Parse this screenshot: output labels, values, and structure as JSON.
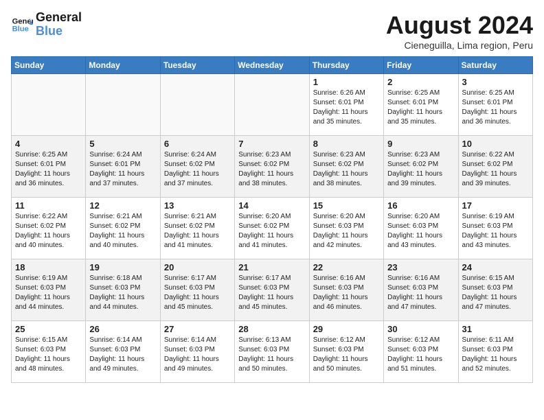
{
  "header": {
    "logo_line1": "General",
    "logo_line2": "Blue",
    "month_title": "August 2024",
    "location": "Cieneguilla, Lima region, Peru"
  },
  "weekdays": [
    "Sunday",
    "Monday",
    "Tuesday",
    "Wednesday",
    "Thursday",
    "Friday",
    "Saturday"
  ],
  "weeks": [
    [
      {
        "day": "",
        "info": ""
      },
      {
        "day": "",
        "info": ""
      },
      {
        "day": "",
        "info": ""
      },
      {
        "day": "",
        "info": ""
      },
      {
        "day": "1",
        "info": "Sunrise: 6:26 AM\nSunset: 6:01 PM\nDaylight: 11 hours\nand 35 minutes."
      },
      {
        "day": "2",
        "info": "Sunrise: 6:25 AM\nSunset: 6:01 PM\nDaylight: 11 hours\nand 35 minutes."
      },
      {
        "day": "3",
        "info": "Sunrise: 6:25 AM\nSunset: 6:01 PM\nDaylight: 11 hours\nand 36 minutes."
      }
    ],
    [
      {
        "day": "4",
        "info": "Sunrise: 6:25 AM\nSunset: 6:01 PM\nDaylight: 11 hours\nand 36 minutes."
      },
      {
        "day": "5",
        "info": "Sunrise: 6:24 AM\nSunset: 6:01 PM\nDaylight: 11 hours\nand 37 minutes."
      },
      {
        "day": "6",
        "info": "Sunrise: 6:24 AM\nSunset: 6:02 PM\nDaylight: 11 hours\nand 37 minutes."
      },
      {
        "day": "7",
        "info": "Sunrise: 6:23 AM\nSunset: 6:02 PM\nDaylight: 11 hours\nand 38 minutes."
      },
      {
        "day": "8",
        "info": "Sunrise: 6:23 AM\nSunset: 6:02 PM\nDaylight: 11 hours\nand 38 minutes."
      },
      {
        "day": "9",
        "info": "Sunrise: 6:23 AM\nSunset: 6:02 PM\nDaylight: 11 hours\nand 39 minutes."
      },
      {
        "day": "10",
        "info": "Sunrise: 6:22 AM\nSunset: 6:02 PM\nDaylight: 11 hours\nand 39 minutes."
      }
    ],
    [
      {
        "day": "11",
        "info": "Sunrise: 6:22 AM\nSunset: 6:02 PM\nDaylight: 11 hours\nand 40 minutes."
      },
      {
        "day": "12",
        "info": "Sunrise: 6:21 AM\nSunset: 6:02 PM\nDaylight: 11 hours\nand 40 minutes."
      },
      {
        "day": "13",
        "info": "Sunrise: 6:21 AM\nSunset: 6:02 PM\nDaylight: 11 hours\nand 41 minutes."
      },
      {
        "day": "14",
        "info": "Sunrise: 6:20 AM\nSunset: 6:02 PM\nDaylight: 11 hours\nand 41 minutes."
      },
      {
        "day": "15",
        "info": "Sunrise: 6:20 AM\nSunset: 6:03 PM\nDaylight: 11 hours\nand 42 minutes."
      },
      {
        "day": "16",
        "info": "Sunrise: 6:20 AM\nSunset: 6:03 PM\nDaylight: 11 hours\nand 43 minutes."
      },
      {
        "day": "17",
        "info": "Sunrise: 6:19 AM\nSunset: 6:03 PM\nDaylight: 11 hours\nand 43 minutes."
      }
    ],
    [
      {
        "day": "18",
        "info": "Sunrise: 6:19 AM\nSunset: 6:03 PM\nDaylight: 11 hours\nand 44 minutes."
      },
      {
        "day": "19",
        "info": "Sunrise: 6:18 AM\nSunset: 6:03 PM\nDaylight: 11 hours\nand 44 minutes."
      },
      {
        "day": "20",
        "info": "Sunrise: 6:17 AM\nSunset: 6:03 PM\nDaylight: 11 hours\nand 45 minutes."
      },
      {
        "day": "21",
        "info": "Sunrise: 6:17 AM\nSunset: 6:03 PM\nDaylight: 11 hours\nand 45 minutes."
      },
      {
        "day": "22",
        "info": "Sunrise: 6:16 AM\nSunset: 6:03 PM\nDaylight: 11 hours\nand 46 minutes."
      },
      {
        "day": "23",
        "info": "Sunrise: 6:16 AM\nSunset: 6:03 PM\nDaylight: 11 hours\nand 47 minutes."
      },
      {
        "day": "24",
        "info": "Sunrise: 6:15 AM\nSunset: 6:03 PM\nDaylight: 11 hours\nand 47 minutes."
      }
    ],
    [
      {
        "day": "25",
        "info": "Sunrise: 6:15 AM\nSunset: 6:03 PM\nDaylight: 11 hours\nand 48 minutes."
      },
      {
        "day": "26",
        "info": "Sunrise: 6:14 AM\nSunset: 6:03 PM\nDaylight: 11 hours\nand 49 minutes."
      },
      {
        "day": "27",
        "info": "Sunrise: 6:14 AM\nSunset: 6:03 PM\nDaylight: 11 hours\nand 49 minutes."
      },
      {
        "day": "28",
        "info": "Sunrise: 6:13 AM\nSunset: 6:03 PM\nDaylight: 11 hours\nand 50 minutes."
      },
      {
        "day": "29",
        "info": "Sunrise: 6:12 AM\nSunset: 6:03 PM\nDaylight: 11 hours\nand 50 minutes."
      },
      {
        "day": "30",
        "info": "Sunrise: 6:12 AM\nSunset: 6:03 PM\nDaylight: 11 hours\nand 51 minutes."
      },
      {
        "day": "31",
        "info": "Sunrise: 6:11 AM\nSunset: 6:03 PM\nDaylight: 11 hours\nand 52 minutes."
      }
    ]
  ]
}
